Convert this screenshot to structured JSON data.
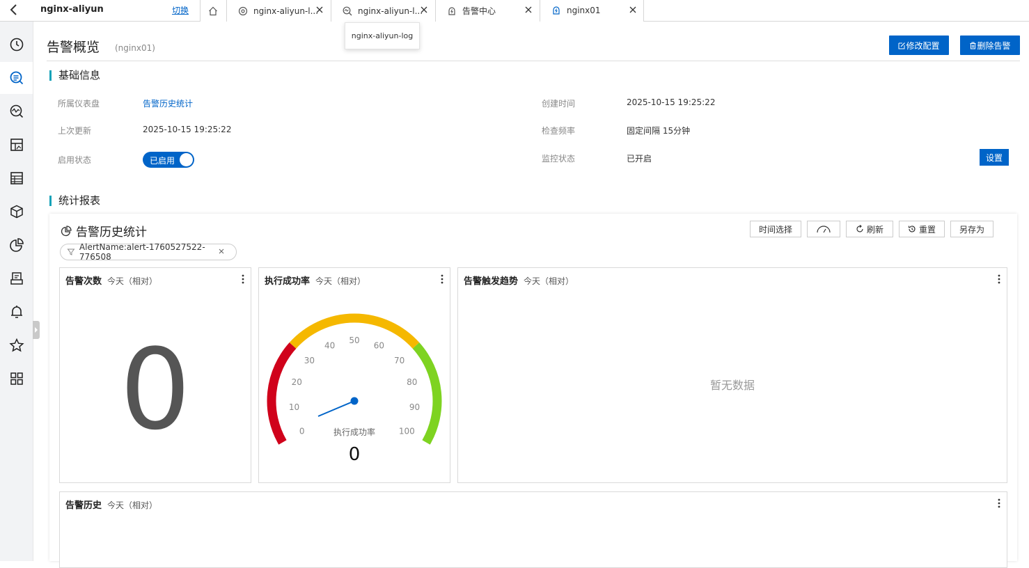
{
  "topbar": {
    "project": "nginx-aliyun",
    "switch_label": "切换",
    "tabs": [
      {
        "label": "nginx-aliyun-l..."
      },
      {
        "label": "nginx-aliyun-l..."
      },
      {
        "label": "告警中心"
      },
      {
        "label": "nginx01"
      }
    ],
    "tooltip": "nginx-aliyun-log"
  },
  "header": {
    "title": "告警概览",
    "subtitle": "(nginx01)",
    "edit_button": "修改配置",
    "delete_button": "删除告警"
  },
  "basic_info": {
    "section_title": "基础信息",
    "dashboard_label": "所属仪表盘",
    "dashboard_value": "告警历史统计",
    "created_label": "创建时间",
    "created_value": "2025-10-15 19:25:22",
    "updated_label": "上次更新",
    "updated_value": "2025-10-15 19:25:22",
    "frequency_label": "检查频率",
    "frequency_value": "固定间隔 15分钟",
    "enabled_label": "启用状态",
    "enabled_value": "已启用",
    "monitor_label": "监控状态",
    "monitor_value": "已开启",
    "settings_button": "设置"
  },
  "report": {
    "section_title": "统计报表",
    "dashboard_title": "告警历史统计",
    "toolbar": {
      "time_select": "时间选择",
      "refresh": "刷新",
      "reset": "重置",
      "save_as": "另存为"
    },
    "filter": "AlertName:alert-1760527522-776508",
    "panels": {
      "count": {
        "name": "告警次数",
        "range": "今天（相对）",
        "value": "0"
      },
      "success": {
        "name": "执行成功率",
        "range": "今天（相对）",
        "gauge_label": "执行成功率",
        "value": "0",
        "ticks": [
          "0",
          "10",
          "20",
          "30",
          "40",
          "50",
          "60",
          "70",
          "80",
          "90",
          "100"
        ],
        "gauge_value": 0,
        "colors": {
          "low": "#d0021b",
          "mid": "#f5b800",
          "high": "#7ed321"
        }
      },
      "trend": {
        "name": "告警触发趋势",
        "range": "今天（相对）",
        "empty": "暂无数据"
      },
      "history": {
        "name": "告警历史",
        "range": "今天（相对）"
      }
    }
  },
  "colors": {
    "primary": "#0064c8",
    "accent": "#17a2b8"
  }
}
